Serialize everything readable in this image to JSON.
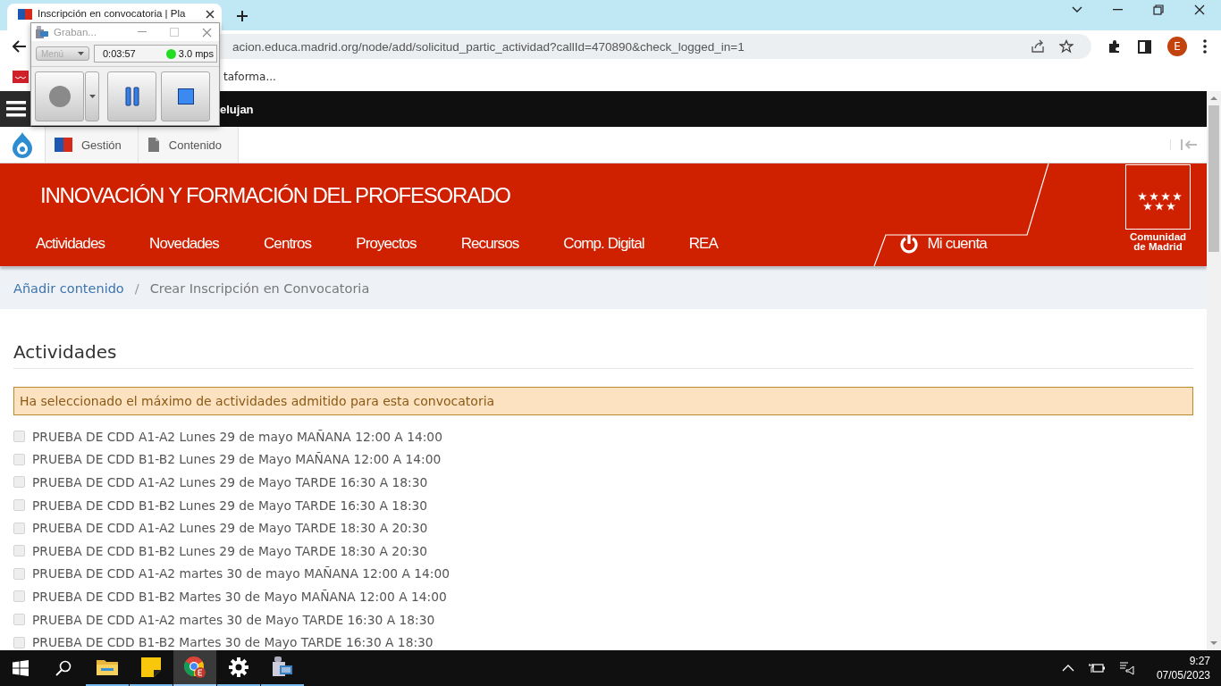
{
  "browser": {
    "tab_title": "Inscripción en convocatoria | Pla",
    "address": "acion.educa.madrid.org/node/add/solicitud_partic_actividad?callId=470890&check_logged_in=1",
    "profile_initial": "E",
    "bookmark": "taforma..."
  },
  "recorder": {
    "title": "Graban...",
    "menu": "Menú",
    "time": "0:03:57",
    "rate": "3.0 mps",
    "recording": true
  },
  "admin_bar": {
    "user": "elujan"
  },
  "toolbar": {
    "items": [
      {
        "label": "Gestión",
        "kind": "logo"
      },
      {
        "label": "Contenido",
        "kind": "page"
      }
    ]
  },
  "header": {
    "title": "INNOVACIÓN Y FORMACIÓN DEL PROFESORADO",
    "nav": [
      "Actividades",
      "Novedades",
      "Centros",
      "Proyectos",
      "Recursos",
      "Comp. Digital",
      "REA"
    ],
    "account": "Mi cuenta",
    "logo_lines": [
      "Comunidad",
      "de Madrid"
    ]
  },
  "breadcrumb": {
    "separator": "/",
    "items": [
      {
        "label": "Añadir contenido",
        "link": true
      },
      {
        "label": "Crear Inscripción en Convocatoria",
        "link": false
      }
    ]
  },
  "section_title": "Actividades",
  "warning": "Ha seleccionado el máximo de actividades admitido para esta convocatoria",
  "activities": [
    {
      "label": "PRUEBA DE CDD A1-A2 Lunes 29 de mayo MAÑANA 12:00 A 14:00",
      "checked": false,
      "disabled": true
    },
    {
      "label": "PRUEBA DE CDD B1-B2 Lunes 29 de Mayo MAÑANA 12:00 A 14:00",
      "checked": false,
      "disabled": true
    },
    {
      "label": "PRUEBA DE CDD A1-A2 Lunes 29 de Mayo TARDE 16:30 A 18:30",
      "checked": false,
      "disabled": true
    },
    {
      "label": "PRUEBA DE CDD B1-B2 Lunes 29 de Mayo TARDE 16:30 A 18:30",
      "checked": false,
      "disabled": true
    },
    {
      "label": "PRUEBA DE CDD A1-A2 Lunes 29 de Mayo TARDE 18:30 A 20:30",
      "checked": false,
      "disabled": true
    },
    {
      "label": "PRUEBA DE CDD B1-B2 Lunes 29 de Mayo TARDE 18:30 A 20:30",
      "checked": false,
      "disabled": true
    },
    {
      "label": "PRUEBA DE CDD A1-A2 martes 30 de mayo MAÑANA 12:00 A 14:00",
      "checked": false,
      "disabled": true
    },
    {
      "label": "PRUEBA DE CDD B1-B2 Martes 30 de Mayo MAÑANA 12:00 A 14:00",
      "checked": false,
      "disabled": true
    },
    {
      "label": "PRUEBA DE CDD A1-A2 martes 30 de Mayo TARDE 16:30 A 18:30",
      "checked": false,
      "disabled": true
    },
    {
      "label": "PRUEBA DE CDD B1-B2 Martes 30 de Mayo TARDE 16:30 A 18:30",
      "checked": false,
      "disabled": true
    }
  ],
  "taskbar": {
    "apps": [
      {
        "kind": "explorer",
        "selected": false
      },
      {
        "kind": "notes",
        "selected": false
      },
      {
        "kind": "chrome",
        "selected": true
      },
      {
        "kind": "settings",
        "selected": false
      },
      {
        "kind": "recorder",
        "selected": false
      }
    ],
    "time": "9:27",
    "date": "07/05/2023"
  }
}
